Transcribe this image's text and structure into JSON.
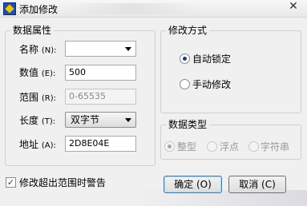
{
  "window": {
    "title": "添加修改",
    "icon": "app-icon",
    "close_glyph": "✕"
  },
  "data_attr": {
    "group_title": "数据属性",
    "name": {
      "label": "名称",
      "hotkey": "(N):",
      "value": ""
    },
    "value": {
      "label": "数值",
      "hotkey": "(E):",
      "value": "500"
    },
    "range": {
      "label": "范围",
      "hotkey": "(R):",
      "value": "0-65535"
    },
    "length": {
      "label": "长度",
      "hotkey": "(T):",
      "value": "双字节"
    },
    "address": {
      "label": "地址",
      "hotkey": "(A):",
      "value": "2D8E04E"
    }
  },
  "modify_mode": {
    "group_title": "修改方式",
    "options": [
      {
        "label": "自动锁定",
        "checked": true
      },
      {
        "label": "手动修改",
        "checked": false
      }
    ]
  },
  "data_type": {
    "group_title": "数据类型",
    "options": [
      {
        "label": "整型",
        "checked": true
      },
      {
        "label": "浮点",
        "checked": false
      },
      {
        "label": "字符串",
        "checked": false
      }
    ]
  },
  "warn_checkbox": {
    "label": "修改超出范围时警告",
    "checked": true,
    "check_glyph": "✓"
  },
  "buttons": {
    "ok": "确定 (O)",
    "cancel": "取消 (C)"
  }
}
